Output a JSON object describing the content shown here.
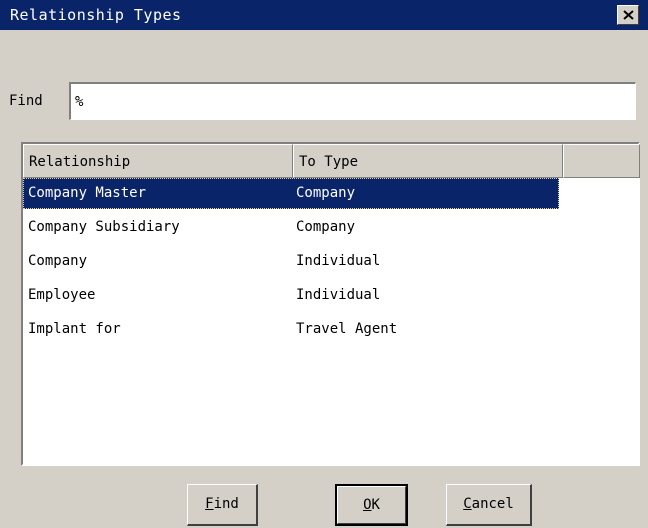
{
  "window": {
    "title": "Relationship Types"
  },
  "find": {
    "label": "Find",
    "value": "%"
  },
  "list": {
    "columns": [
      "Relationship",
      "To Type"
    ],
    "rows": [
      {
        "relationship": "Company Master",
        "to_type": "Company",
        "selected": true
      },
      {
        "relationship": "Company Subsidiary",
        "to_type": "Company"
      },
      {
        "relationship": "Company",
        "to_type": "Individual"
      },
      {
        "relationship": "Employee",
        "to_type": "Individual"
      },
      {
        "relationship": "Implant for",
        "to_type": "Travel Agent"
      }
    ]
  },
  "buttons": {
    "find": {
      "mnemonic": "F",
      "rest": "ind"
    },
    "ok": {
      "mnemonic": "O",
      "rest": "K"
    },
    "cancel": {
      "mnemonic": "C",
      "rest": "ancel"
    }
  },
  "colors": {
    "titlebar": "#0a246a",
    "face": "#d4d0c8",
    "selection": "#0a246a"
  },
  "icons": {
    "close": "close-icon"
  }
}
